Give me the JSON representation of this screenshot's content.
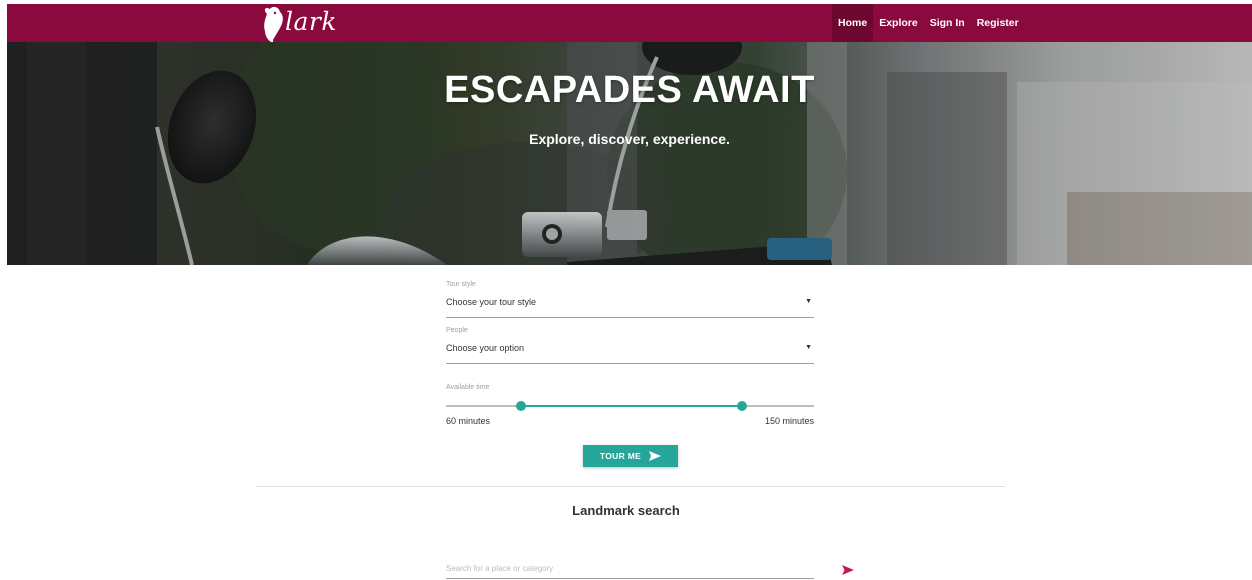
{
  "nav": {
    "logo_text": "lark",
    "links": [
      {
        "label": "Home",
        "active": true
      },
      {
        "label": "Explore",
        "active": false
      },
      {
        "label": "Sign In",
        "active": false
      },
      {
        "label": "Register",
        "active": false
      }
    ]
  },
  "hero": {
    "title": "ESCAPADES AWAIT",
    "subtitle": "Explore, discover, experience."
  },
  "form": {
    "tour_style": {
      "label": "Tour style",
      "value": "Choose your tour style"
    },
    "people": {
      "label": "People",
      "value": "Choose your option"
    },
    "available_time": {
      "label": "Available time",
      "min_label": "60 minutes",
      "max_label": "150 minutes",
      "low_fraction": 0.205,
      "high_fraction": 0.805
    },
    "submit_label": "TOUR ME"
  },
  "landmark": {
    "title": "Landmark search",
    "search_placeholder": "Search for a place or category"
  },
  "colors": {
    "brand": "#8a0a3e",
    "accent": "#26a69a",
    "send_icon": "#c2185b"
  },
  "icons": {
    "logo": "bird-logo-icon",
    "select_arrow": "dropdown-arrow-icon",
    "tour_send": "send-icon",
    "search_send": "send-icon"
  }
}
